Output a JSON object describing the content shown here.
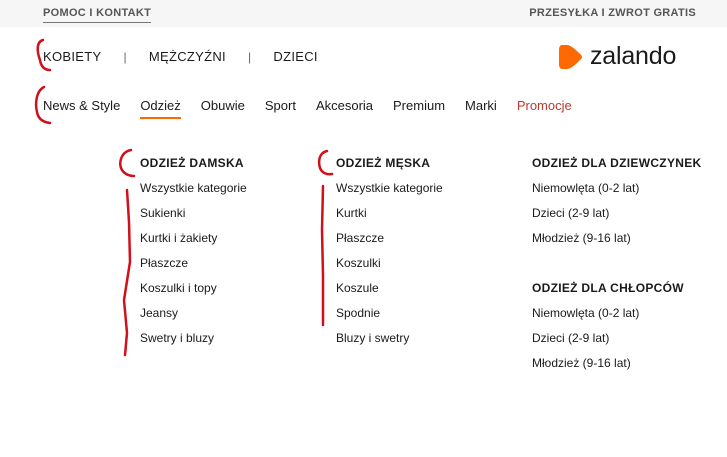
{
  "topbar": {
    "help": "POMOC I KONTAKT",
    "shipping": "PRZESYŁKA I ZWROT GRATIS"
  },
  "gender_nav": [
    "KOBIETY",
    "MĘŻCZYŹNI",
    "DZIECI"
  ],
  "separator": "|",
  "logo": {
    "text": "zalando",
    "color": "#ff6900"
  },
  "category_nav": [
    "News & Style",
    "Odzież",
    "Obuwie",
    "Sport",
    "Akcesoria",
    "Premium",
    "Marki",
    "Promocje"
  ],
  "category_active": "Odzież",
  "promo_color": "#c0392b",
  "menu": {
    "women": {
      "title": "ODZIEŻ DAMSKA",
      "links": [
        "Wszystkie kategorie",
        "Sukienki",
        "Kurtki i żakiety",
        "Płaszcze",
        "Koszulki i topy",
        "Jeansy",
        "Swetry i bluzy"
      ]
    },
    "men": {
      "title": "ODZIEŻ MĘSKA",
      "links": [
        "Wszystkie kategorie",
        "Kurtki",
        "Płaszcze",
        "Koszulki",
        "Koszule",
        "Spodnie",
        "Bluzy i swetry"
      ]
    },
    "girls": {
      "title": "ODZIEŻ DLA DZIEWCZYNEK",
      "links": [
        "Niemowlęta (0-2 lat)",
        "Dzieci (2-9 lat)",
        "Młodzież (9-16 lat)"
      ]
    },
    "boys": {
      "title": "ODZIEŻ DLA CHŁOPCÓW",
      "links": [
        "Niemowlęta (0-2 lat)",
        "Dzieci (2-9 lat)",
        "Młodzież (9-16 lat)"
      ]
    }
  },
  "annotation_color": "#d0101a"
}
